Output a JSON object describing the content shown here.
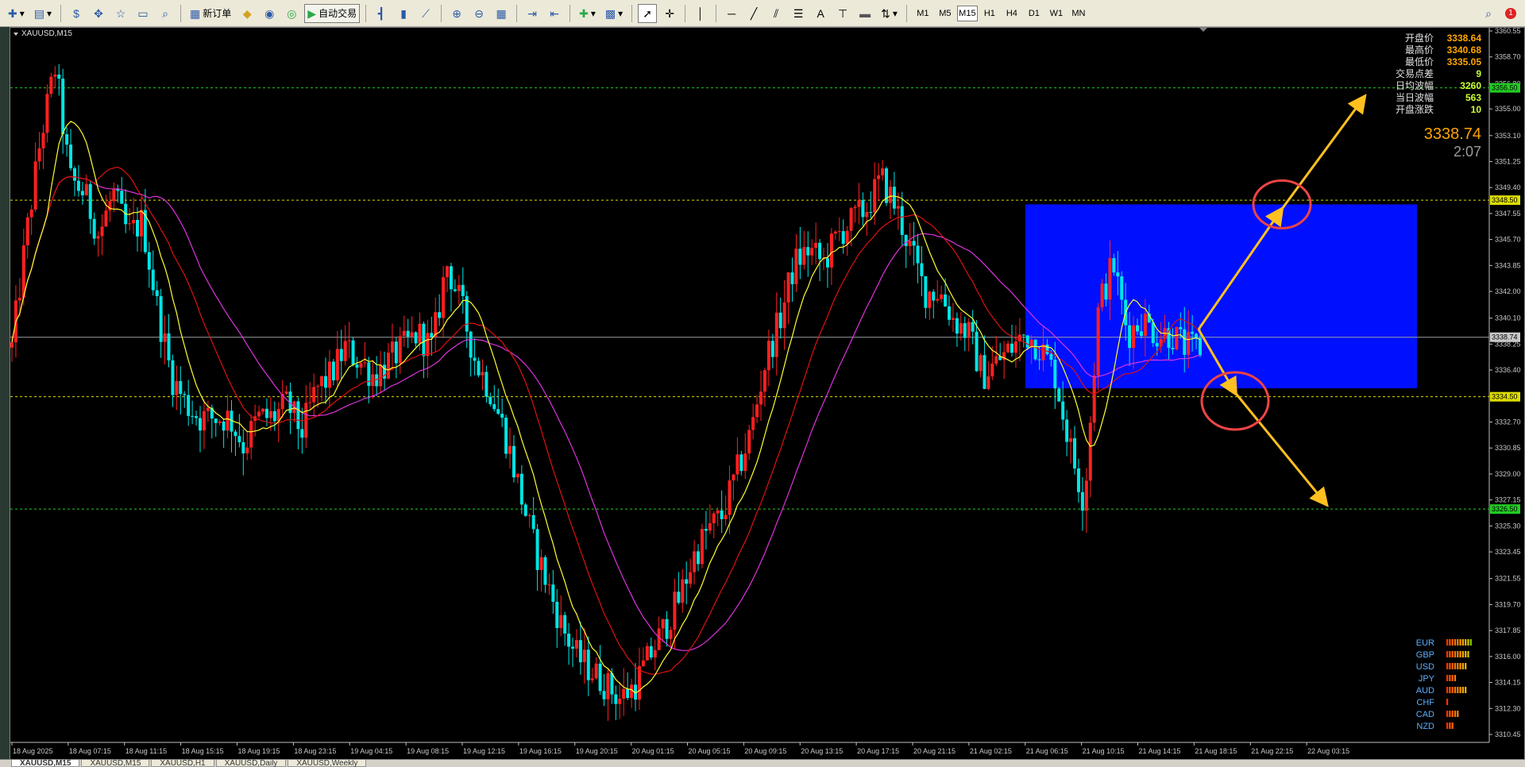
{
  "toolbar": {
    "new_order_label": "新订单",
    "auto_trading_label": "自动交易",
    "timeframes": [
      "M1",
      "M5",
      "M15",
      "H1",
      "H4",
      "D1",
      "W1",
      "MN"
    ],
    "active_timeframe": "M15",
    "icons": [
      "new-chart-icon",
      "profiles-icon",
      "market-watch-icon",
      "navigator-icon",
      "data-window-icon",
      "terminal-icon",
      "tester-icon",
      "meta-editor-icon",
      "gold-icon",
      "signals-icon",
      "bar-chart-icon",
      "candle-chart-icon",
      "line-chart-icon",
      "zoom-in-icon",
      "zoom-out-icon",
      "tile-windows-icon",
      "auto-scroll-icon",
      "chart-shift-icon",
      "indicators-icon",
      "templates-icon",
      "cursor-icon",
      "crosshair-icon",
      "vertical-line-icon",
      "horizontal-line-icon",
      "trendline-icon",
      "channel-icon",
      "fibo-icon",
      "text-icon",
      "text-label-icon",
      "rectangle-icon",
      "arrows-icon",
      "search-icon",
      "notifications-icon"
    ],
    "notification_count": "1"
  },
  "chart": {
    "symbol_label": "XAUUSD,M15",
    "info_panel": [
      {
        "label": "开盘价",
        "value": "3338.64",
        "color": "#ffa500"
      },
      {
        "label": "最高价",
        "value": "3340.68",
        "color": "#ffa500"
      },
      {
        "label": "最低价",
        "value": "3335.05",
        "color": "#ffa500"
      },
      {
        "label": "交易点差",
        "value": "9",
        "color": "#ccff33"
      },
      {
        "label": "日均波幅",
        "value": "3260",
        "color": "#ccff33"
      },
      {
        "label": "当日波幅",
        "value": "563",
        "color": "#ccff33"
      },
      {
        "label": "开盘涨跌",
        "value": "10",
        "color": "#ccff33"
      }
    ],
    "current_price": "3338.74",
    "countdown": "2:07",
    "price_axis": [
      "3360.55",
      "3358.70",
      "3356.80",
      "3355.00",
      "3353.10",
      "3351.25",
      "3349.40",
      "3347.55",
      "3345.70",
      "3343.85",
      "3342.00",
      "3340.10",
      "3338.25",
      "3336.40",
      "3334.55",
      "3332.70",
      "3330.85",
      "3329.00",
      "3327.15",
      "3325.30",
      "3323.45",
      "3321.55",
      "3319.70",
      "3317.85",
      "3316.00",
      "3314.15",
      "3312.30",
      "3310.45"
    ],
    "price_min": 3310.45,
    "price_max": 3360.55,
    "hlines": [
      {
        "price": 3356.5,
        "color": "#22cc22",
        "label": "3356.50",
        "label_bg": "#22cc22"
      },
      {
        "price": 3348.5,
        "color": "#dddd00",
        "label": "3348.50",
        "label_bg": "#dddd00"
      },
      {
        "price": 3334.5,
        "color": "#dddd00",
        "label": "3334.50",
        "label_bg": "#dddd00"
      },
      {
        "price": 3326.5,
        "color": "#22cc22",
        "label": "3326.50",
        "label_bg": "#22cc22"
      }
    ],
    "bid_line_price": 3338.74,
    "time_axis": [
      "18 Aug 2025",
      "18 Aug 07:15",
      "18 Aug 11:15",
      "18 Aug 15:15",
      "18 Aug 19:15",
      "18 Aug 23:15",
      "19 Aug 04:15",
      "19 Aug 08:15",
      "19 Aug 12:15",
      "19 Aug 16:15",
      "19 Aug 20:15",
      "20 Aug 01:15",
      "20 Aug 05:15",
      "20 Aug 09:15",
      "20 Aug 13:15",
      "20 Aug 17:15",
      "20 Aug 21:15",
      "21 Aug 02:15",
      "21 Aug 06:15",
      "21 Aug 10:15",
      "21 Aug 14:15",
      "21 Aug 18:15",
      "21 Aug 22:15",
      "22 Aug 03:15"
    ],
    "price_path": [
      3338,
      3346,
      3353,
      3358,
      3350,
      3349,
      3346,
      3349,
      3346,
      3347,
      3341,
      3336,
      3334,
      3333,
      3333,
      3333,
      3331,
      3333,
      3333,
      3334,
      3332,
      3335,
      3336,
      3338,
      3337,
      3336,
      3337,
      3338,
      3339,
      3338,
      3344,
      3341,
      3337,
      3335,
      3332,
      3328,
      3324,
      3321,
      3318,
      3316,
      3315,
      3314,
      3313,
      3314,
      3316,
      3318,
      3320,
      3323,
      3325,
      3326,
      3329,
      3332,
      3337,
      3340,
      3344,
      3345,
      3344,
      3346,
      3347,
      3348,
      3350,
      3348,
      3345,
      3342,
      3342,
      3340,
      3339,
      3336,
      3337,
      3338,
      3339,
      3338,
      3336,
      3331,
      3327,
      3341,
      3344,
      3339,
      3340,
      3339,
      3339,
      3338,
      3338
    ],
    "colors": {
      "bull": "#ff2020",
      "bear": "#00e5e5",
      "ma_fast": "#ffff33",
      "ma_mid": "#dd1111",
      "ma_slow": "#dd33dd",
      "box": "#0010ff",
      "arrow": "#ffc020",
      "circle": "#ee4444"
    },
    "currency_strength": [
      {
        "name": "EUR",
        "bars": 10
      },
      {
        "name": "GBP",
        "bars": 9
      },
      {
        "name": "USD",
        "bars": 8
      },
      {
        "name": "JPY",
        "bars": 4
      },
      {
        "name": "AUD",
        "bars": 8
      },
      {
        "name": "CHF",
        "bars": 1
      },
      {
        "name": "CAD",
        "bars": 5
      },
      {
        "name": "NZD",
        "bars": 3
      }
    ]
  },
  "tabs": [
    "XAUUSD,M15",
    "XAUUSD,M15",
    "XAUUSD,H1",
    "XAUUSD,Daily",
    "XAUUSD,Weekly"
  ],
  "active_tab": 0
}
